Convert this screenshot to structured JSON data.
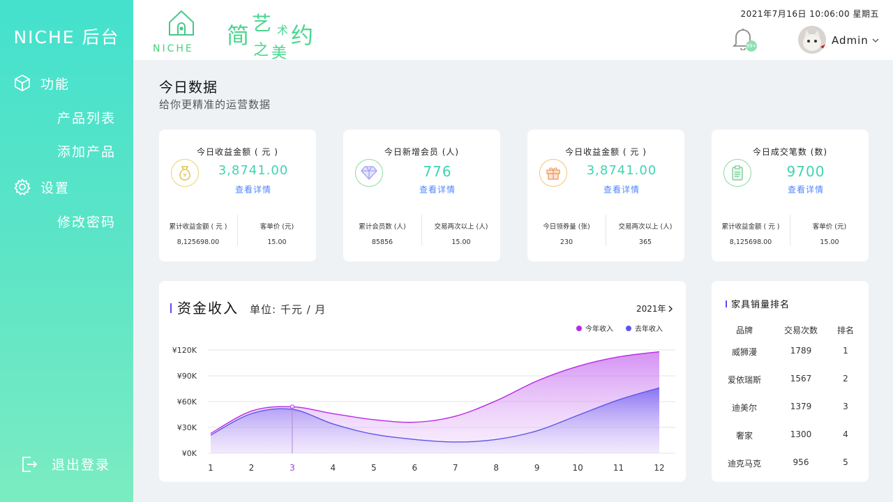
{
  "sidebar": {
    "brand": "NICHE 后台",
    "items": [
      {
        "label": "功能",
        "icon": "cube-icon"
      },
      {
        "label": "产品列表"
      },
      {
        "label": "添加产品"
      },
      {
        "label": "设置",
        "icon": "gear-icon"
      },
      {
        "label": "修改密码"
      }
    ],
    "logout": "退出登录"
  },
  "header": {
    "logo_text": "NICHE",
    "slogan": {
      "c1": "简",
      "c2": "艺",
      "c3": "术",
      "c4": "约",
      "c5": "之",
      "c6": "美"
    },
    "datetime": "2021年7月16日  10:06:00  星期五",
    "notification_badge": "99+",
    "username": "Admin"
  },
  "main": {
    "title": "今日数据",
    "subtitle": "给你更精准的运营数据"
  },
  "stats": [
    {
      "title": "今日收益金额 ( 元 )",
      "icon": "money-bag-icon",
      "color": "#e9d36c",
      "value": "3,8741.00",
      "link": "查看详情",
      "sub": [
        {
          "label": "累计收益金额 ( 元 )",
          "value": "8,125698.00"
        },
        {
          "label": "客单价 (元)",
          "value": "15.00"
        }
      ]
    },
    {
      "title": "今日新增会员 (人)",
      "icon": "diamond-icon",
      "color": "#8fd8a4",
      "value": "776",
      "link": "查看详情",
      "sub": [
        {
          "label": "累计会员数 (人)",
          "value": "85856"
        },
        {
          "label": "交易两次以上 (人)",
          "value": "15.00"
        }
      ]
    },
    {
      "title": "今日收益金额 ( 元 )",
      "icon": "gift-icon",
      "color": "#f0c67a",
      "value": "3,8741.00",
      "link": "查看详情",
      "sub": [
        {
          "label": "今日领券量 (张)",
          "value": "230"
        },
        {
          "label": "交易两次以上 (人)",
          "value": "365"
        }
      ]
    },
    {
      "title": "今日成交笔数 (数)",
      "icon": "clipboard-icon",
      "color": "#8fd8a4",
      "value": "9700",
      "link": "查看详情",
      "sub": [
        {
          "label": "累计收益金额 ( 元 )",
          "value": "8,125698.00"
        },
        {
          "label": "客单价 (元)",
          "value": "15.00"
        }
      ]
    }
  ],
  "income": {
    "title": "资金收入",
    "unit": "单位: 千元 / 月",
    "year": "2021年",
    "highlight_x_label": "3"
  },
  "chart_data": {
    "type": "area",
    "title": "资金收入",
    "ylabel": "单位: 千元 / 月",
    "x": [
      "1",
      "2",
      "3",
      "4",
      "5",
      "6",
      "7",
      "8",
      "9",
      "10",
      "11",
      "12"
    ],
    "y_ticks": [
      "¥0K",
      "¥30K",
      "¥60K",
      "¥90K",
      "¥120K"
    ],
    "ylim": [
      0,
      120
    ],
    "legend_position": "top-right",
    "series": [
      {
        "name": "今年收入",
        "color": "#b629e6",
        "values": [
          23,
          49,
          54,
          46,
          39,
          36,
          43,
          61,
          84,
          101,
          112,
          118
        ]
      },
      {
        "name": "去年收入",
        "color": "#5b56e8",
        "values": [
          21,
          46,
          51,
          34,
          22,
          16,
          13,
          16,
          26,
          44,
          62,
          76
        ]
      }
    ]
  },
  "ranking": {
    "title": "家具销量排名",
    "headers": [
      "品牌",
      "交易次数",
      "排名"
    ],
    "rows": [
      [
        "威狮漫",
        "1789",
        "1"
      ],
      [
        "爱依瑞斯",
        "1567",
        "2"
      ],
      [
        "迪美尔",
        "1379",
        "3"
      ],
      [
        "奢家",
        "1300",
        "4"
      ],
      [
        "迪克马克",
        "956",
        "5"
      ]
    ]
  }
}
